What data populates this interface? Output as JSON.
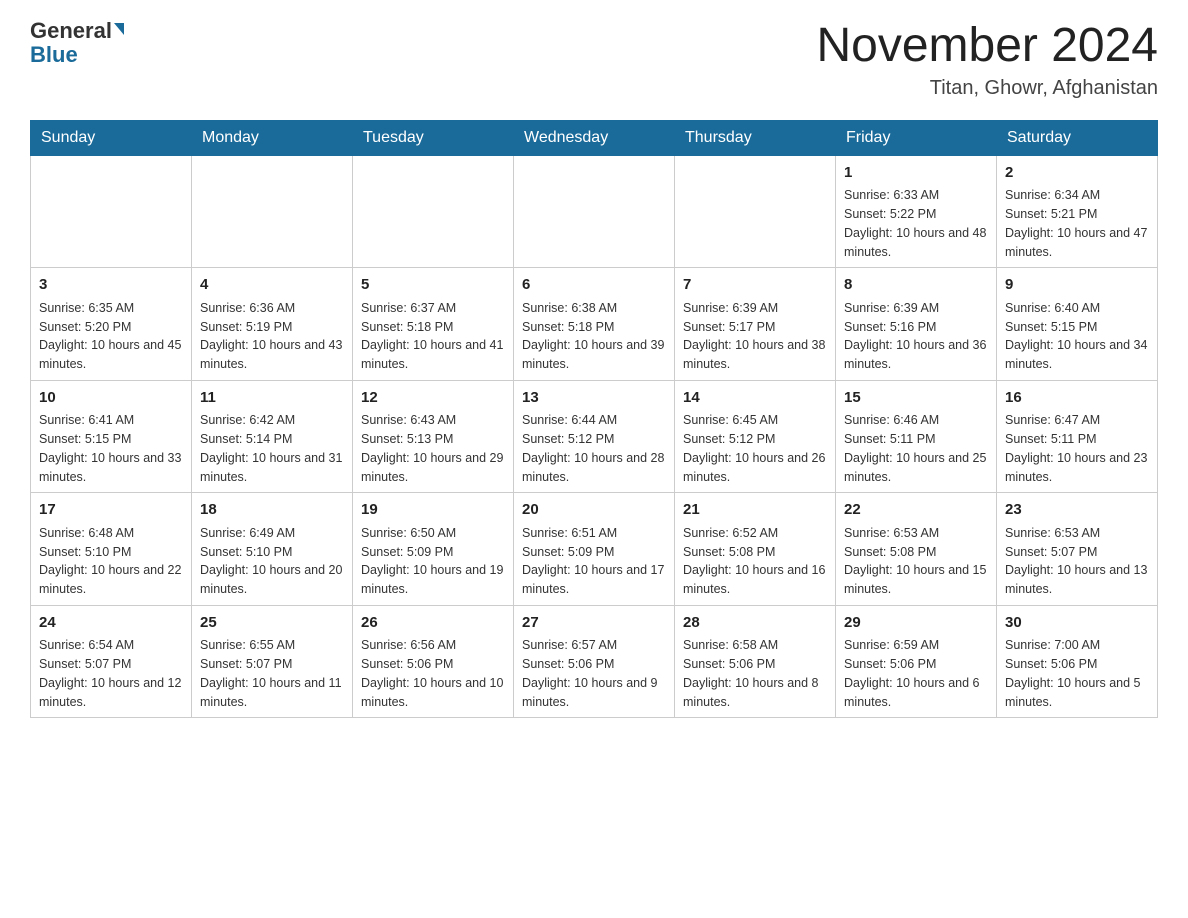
{
  "logo": {
    "general": "General",
    "blue": "Blue"
  },
  "header": {
    "title": "November 2024",
    "subtitle": "Titan, Ghowr, Afghanistan"
  },
  "days_of_week": [
    "Sunday",
    "Monday",
    "Tuesday",
    "Wednesday",
    "Thursday",
    "Friday",
    "Saturday"
  ],
  "weeks": [
    [
      {
        "day": "",
        "info": ""
      },
      {
        "day": "",
        "info": ""
      },
      {
        "day": "",
        "info": ""
      },
      {
        "day": "",
        "info": ""
      },
      {
        "day": "",
        "info": ""
      },
      {
        "day": "1",
        "info": "Sunrise: 6:33 AM\nSunset: 5:22 PM\nDaylight: 10 hours and 48 minutes."
      },
      {
        "day": "2",
        "info": "Sunrise: 6:34 AM\nSunset: 5:21 PM\nDaylight: 10 hours and 47 minutes."
      }
    ],
    [
      {
        "day": "3",
        "info": "Sunrise: 6:35 AM\nSunset: 5:20 PM\nDaylight: 10 hours and 45 minutes."
      },
      {
        "day": "4",
        "info": "Sunrise: 6:36 AM\nSunset: 5:19 PM\nDaylight: 10 hours and 43 minutes."
      },
      {
        "day": "5",
        "info": "Sunrise: 6:37 AM\nSunset: 5:18 PM\nDaylight: 10 hours and 41 minutes."
      },
      {
        "day": "6",
        "info": "Sunrise: 6:38 AM\nSunset: 5:18 PM\nDaylight: 10 hours and 39 minutes."
      },
      {
        "day": "7",
        "info": "Sunrise: 6:39 AM\nSunset: 5:17 PM\nDaylight: 10 hours and 38 minutes."
      },
      {
        "day": "8",
        "info": "Sunrise: 6:39 AM\nSunset: 5:16 PM\nDaylight: 10 hours and 36 minutes."
      },
      {
        "day": "9",
        "info": "Sunrise: 6:40 AM\nSunset: 5:15 PM\nDaylight: 10 hours and 34 minutes."
      }
    ],
    [
      {
        "day": "10",
        "info": "Sunrise: 6:41 AM\nSunset: 5:15 PM\nDaylight: 10 hours and 33 minutes."
      },
      {
        "day": "11",
        "info": "Sunrise: 6:42 AM\nSunset: 5:14 PM\nDaylight: 10 hours and 31 minutes."
      },
      {
        "day": "12",
        "info": "Sunrise: 6:43 AM\nSunset: 5:13 PM\nDaylight: 10 hours and 29 minutes."
      },
      {
        "day": "13",
        "info": "Sunrise: 6:44 AM\nSunset: 5:12 PM\nDaylight: 10 hours and 28 minutes."
      },
      {
        "day": "14",
        "info": "Sunrise: 6:45 AM\nSunset: 5:12 PM\nDaylight: 10 hours and 26 minutes."
      },
      {
        "day": "15",
        "info": "Sunrise: 6:46 AM\nSunset: 5:11 PM\nDaylight: 10 hours and 25 minutes."
      },
      {
        "day": "16",
        "info": "Sunrise: 6:47 AM\nSunset: 5:11 PM\nDaylight: 10 hours and 23 minutes."
      }
    ],
    [
      {
        "day": "17",
        "info": "Sunrise: 6:48 AM\nSunset: 5:10 PM\nDaylight: 10 hours and 22 minutes."
      },
      {
        "day": "18",
        "info": "Sunrise: 6:49 AM\nSunset: 5:10 PM\nDaylight: 10 hours and 20 minutes."
      },
      {
        "day": "19",
        "info": "Sunrise: 6:50 AM\nSunset: 5:09 PM\nDaylight: 10 hours and 19 minutes."
      },
      {
        "day": "20",
        "info": "Sunrise: 6:51 AM\nSunset: 5:09 PM\nDaylight: 10 hours and 17 minutes."
      },
      {
        "day": "21",
        "info": "Sunrise: 6:52 AM\nSunset: 5:08 PM\nDaylight: 10 hours and 16 minutes."
      },
      {
        "day": "22",
        "info": "Sunrise: 6:53 AM\nSunset: 5:08 PM\nDaylight: 10 hours and 15 minutes."
      },
      {
        "day": "23",
        "info": "Sunrise: 6:53 AM\nSunset: 5:07 PM\nDaylight: 10 hours and 13 minutes."
      }
    ],
    [
      {
        "day": "24",
        "info": "Sunrise: 6:54 AM\nSunset: 5:07 PM\nDaylight: 10 hours and 12 minutes."
      },
      {
        "day": "25",
        "info": "Sunrise: 6:55 AM\nSunset: 5:07 PM\nDaylight: 10 hours and 11 minutes."
      },
      {
        "day": "26",
        "info": "Sunrise: 6:56 AM\nSunset: 5:06 PM\nDaylight: 10 hours and 10 minutes."
      },
      {
        "day": "27",
        "info": "Sunrise: 6:57 AM\nSunset: 5:06 PM\nDaylight: 10 hours and 9 minutes."
      },
      {
        "day": "28",
        "info": "Sunrise: 6:58 AM\nSunset: 5:06 PM\nDaylight: 10 hours and 8 minutes."
      },
      {
        "day": "29",
        "info": "Sunrise: 6:59 AM\nSunset: 5:06 PM\nDaylight: 10 hours and 6 minutes."
      },
      {
        "day": "30",
        "info": "Sunrise: 7:00 AM\nSunset: 5:06 PM\nDaylight: 10 hours and 5 minutes."
      }
    ]
  ]
}
